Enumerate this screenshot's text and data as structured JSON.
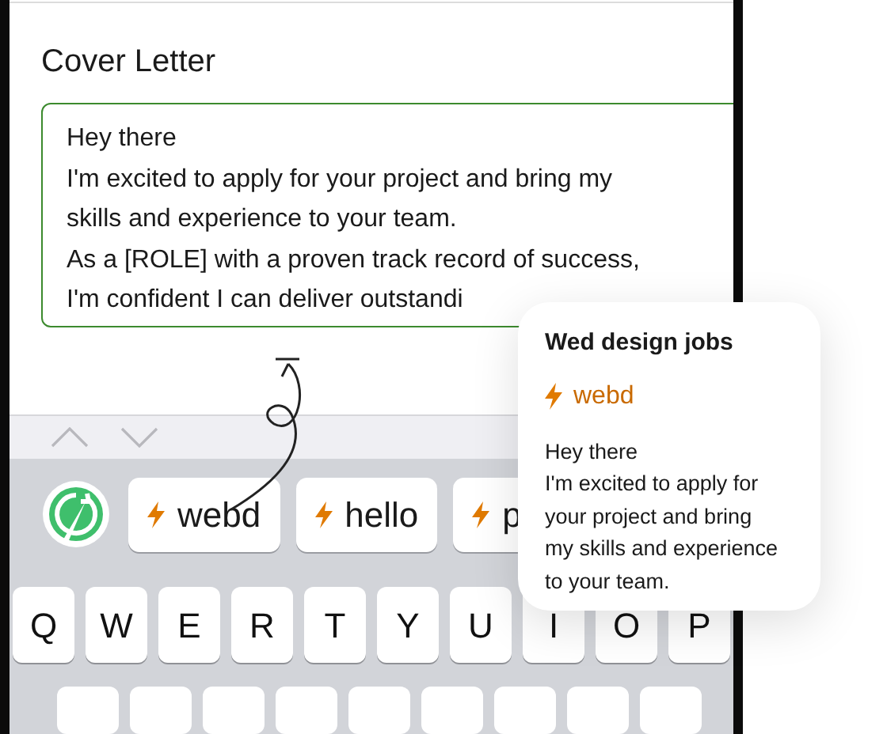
{
  "form": {
    "label": "Cover Letter",
    "lines": [
      "Hey there",
      "I'm excited to apply for your project and bring my",
      "skills and experience to your team.",
      "As a [ROLE] with a proven track record of success,",
      "I'm confident I can deliver outstandi"
    ],
    "focused": true
  },
  "suggestions": [
    {
      "label": "webd"
    },
    {
      "label": "hello"
    },
    {
      "label": "p"
    }
  ],
  "keys": [
    "Q",
    "W",
    "E",
    "R",
    "T",
    "Y",
    "U",
    "I",
    "O",
    "P"
  ],
  "popup": {
    "title": "Wed design jobs",
    "shortcut": "webd",
    "body": [
      "Hey there",
      "I'm excited to apply for",
      "your project and bring",
      "my skills and experience",
      "to your team."
    ]
  }
}
